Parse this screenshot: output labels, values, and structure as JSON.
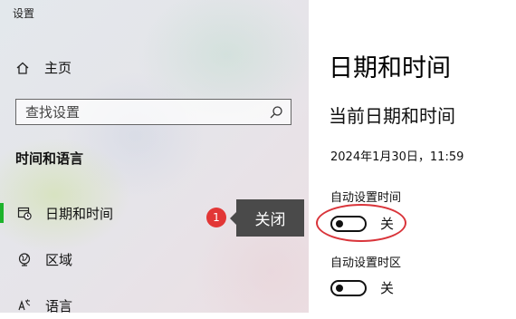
{
  "window": {
    "title": "设置"
  },
  "sidebar": {
    "home_label": "主页",
    "search_placeholder": "查找设置",
    "section_heading": "时间和语言",
    "items": [
      {
        "label": "日期和时间",
        "icon": "calendar-clock-icon",
        "active": true
      },
      {
        "label": "区域",
        "icon": "globe-region-icon",
        "active": false
      },
      {
        "label": "语言",
        "icon": "language-icon",
        "active": false
      }
    ]
  },
  "annotation": {
    "badge": "1",
    "tooltip": "关闭"
  },
  "main": {
    "title": "日期和时间",
    "subtitle": "当前日期和时间",
    "current_datetime": "2024年1月30日，11:59",
    "settings": [
      {
        "label": "自动设置时间",
        "state": "关",
        "on": false
      },
      {
        "label": "自动设置时区",
        "state": "关",
        "on": false
      }
    ]
  },
  "colors": {
    "accent": "#1db32b",
    "highlight": "#d9343a",
    "badge": "#e23636",
    "tooltip_bg": "#4a4a4a"
  }
}
